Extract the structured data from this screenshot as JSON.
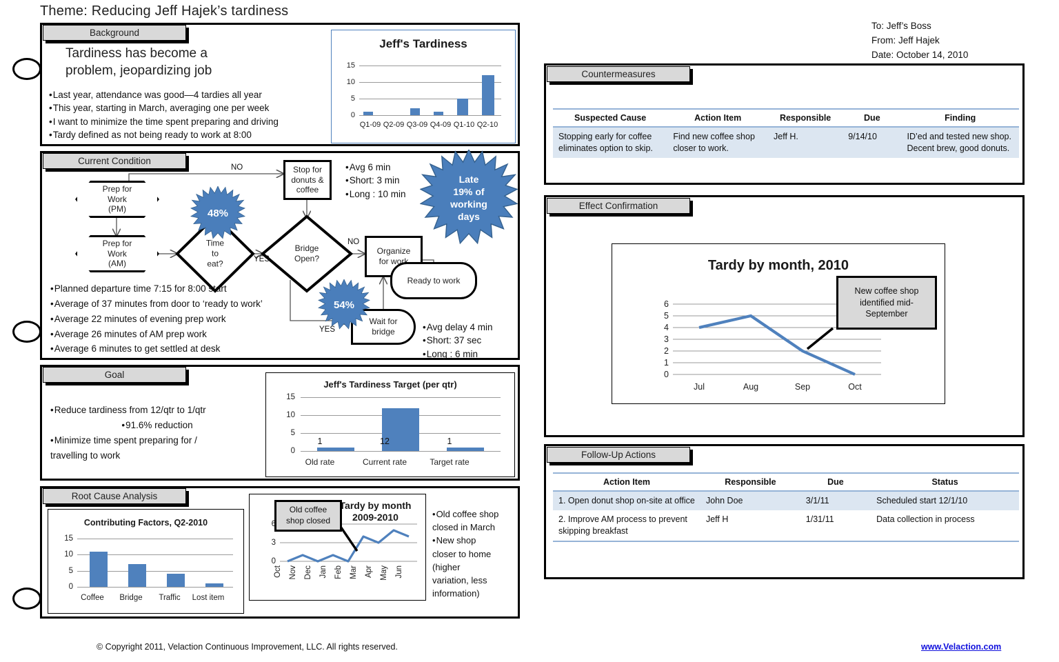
{
  "page": {
    "title": "Theme: Reducing Jeff Hajek’s tardiness",
    "footer_copyright": "© Copyright 2011, Velaction Continuous Improvement, LLC. All rights reserved.",
    "footer_link": "www.Velaction.com",
    "accent_blue": "#4F81BD",
    "burst_blue": "#4A7EBB",
    "header_gray": "#d9d9d9",
    "table_rule": "#95b3d7",
    "table_row_fill": "#dce6f1"
  },
  "memo": {
    "to": "To: Jeff’s Boss",
    "from": "From: Jeff Hajek",
    "date": "Date: October 14, 2010"
  },
  "background": {
    "header": "Background",
    "headline_line1": "Tardiness has become a",
    "headline_line2": "problem, jeopardizing  job",
    "bullets": [
      "Last year, attendance was good—4 tardies all year",
      "This year, starting in March, averaging one per week",
      "I want to minimize the time spent preparing and driving",
      "Tardy defined as not being ready to work at 8:00"
    ]
  },
  "current_condition": {
    "header": "Current Condition",
    "nodes": {
      "prep_pm": "Prep for Work (PM)",
      "prep_pm_l1": "Prep for",
      "prep_pm_l2": "Work",
      "prep_pm_l3": "(PM)",
      "prep_am_l1": "Prep for",
      "prep_am_l2": "Work",
      "prep_am_l3": "(AM)",
      "time_to_eat_l1": "Time",
      "time_to_eat_l2": "to",
      "time_to_eat_l3": "eat?",
      "stop_donuts_l1": "Stop for",
      "stop_donuts_l2": "donuts &",
      "stop_donuts_l3": "coffee",
      "bridge_open_l1": "Bridge",
      "bridge_open_l2": "Open?",
      "organize_l1": "Organize",
      "organize_l2": "for work",
      "wait_bridge_l1": "Wait for",
      "wait_bridge_l2": "bridge",
      "ready_to_work": "Ready to work"
    },
    "edge_labels": {
      "no_top": "NO",
      "yes_eat": "YES",
      "no_bridge": "NO",
      "yes_bridge": "YES"
    },
    "bursts": {
      "eat_pct": "48%",
      "bridge_pct": "54%",
      "late_l1": "Late",
      "late_l2": "19% of",
      "late_l3": "working",
      "late_l4": "days"
    },
    "coffee_stats": [
      "Avg 6 min",
      "Short: 3 min",
      "Long : 10 min"
    ],
    "bridge_stats": [
      "Avg delay 4 min",
      "Short: 37 sec",
      "Long : 6 min"
    ],
    "bullets": [
      "Planned departure time 7:15 for 8:00 start",
      "Average of 37 minutes from door to ‘ready to work’",
      "Average 22 minutes of evening prep work",
      "Average 26 minutes of AM prep work",
      "Average 6 minutes to get settled at desk"
    ]
  },
  "goal": {
    "header": "Goal",
    "bullets": [
      "Reduce tardiness from 12/qtr to 1/qtr",
      "91.6% reduction",
      "Minimize time spent preparing for /",
      "travelling to work"
    ]
  },
  "root_cause": {
    "header": "Root Cause Analysis",
    "callout_l1": "Old coffee",
    "callout_l2": "shop closed",
    "notes": [
      "Old coffee shop",
      "closed in March",
      "New shop",
      "closer to home",
      "(higher",
      "variation, less",
      "information)"
    ]
  },
  "countermeasures": {
    "header": "Countermeasures",
    "columns": [
      "Suspected Cause",
      "Action Item",
      "Responsible",
      "Due",
      "Finding"
    ],
    "rows": [
      {
        "cause": "Stopping early for coffee eliminates option to skip.",
        "action": "Find new coffee shop closer to work.",
        "responsible": "Jeff H.",
        "due": "9/14/10",
        "finding": "ID’ed and tested new shop. Decent brew, good donuts."
      }
    ]
  },
  "effect_confirmation": {
    "header": "Effect Confirmation",
    "callout_l1": "New coffee shop",
    "callout_l2": "identified mid-",
    "callout_l3": "September"
  },
  "follow_up": {
    "header": "Follow-Up Actions",
    "columns": [
      "Action Item",
      "Responsible",
      "Due",
      "Status"
    ],
    "rows": [
      {
        "action": "1. Open donut shop on-site at office",
        "responsible": "John Doe",
        "due": "3/1/11",
        "status": "Scheduled start 12/1/10"
      },
      {
        "action": "2. Improve AM process to prevent skipping breakfast",
        "responsible": "Jeff H",
        "due": "1/31/11",
        "status": "Data collection in process"
      }
    ]
  },
  "chart_data": [
    {
      "id": "jeffs_tardiness",
      "type": "bar",
      "title": "Jeff's Tardiness",
      "categories": [
        "Q1-09",
        "Q2-09",
        "Q3-09",
        "Q4-09",
        "Q1-10",
        "Q2-10"
      ],
      "values": [
        1,
        0,
        2,
        1,
        5,
        12
      ],
      "yticks": [
        0,
        5,
        10,
        15
      ],
      "ylim": [
        0,
        15
      ],
      "xlabel": "",
      "ylabel": "",
      "grid": true,
      "legend": "none",
      "color": "#4F81BD"
    },
    {
      "id": "tardiness_target",
      "type": "bar",
      "title": "Jeff's Tardiness Target (per qtr)",
      "categories": [
        "Old rate",
        "Current rate",
        "Target rate"
      ],
      "values": [
        1,
        12,
        1
      ],
      "data_labels": [
        "1",
        "12",
        "1"
      ],
      "yticks": [
        0,
        5,
        10,
        15
      ],
      "ylim": [
        0,
        15
      ],
      "xlabel": "",
      "ylabel": "",
      "grid": true,
      "legend": "none",
      "color": "#4F81BD"
    },
    {
      "id": "contributing_factors",
      "type": "bar",
      "title": "Contributing Factors, Q2-2010",
      "categories": [
        "Coffee",
        "Bridge",
        "Traffic",
        "Lost item"
      ],
      "values": [
        11,
        7,
        4,
        1
      ],
      "yticks": [
        0,
        5,
        10,
        15
      ],
      "ylim": [
        0,
        15
      ],
      "xlabel": "",
      "ylabel": "",
      "grid": true,
      "legend": "none",
      "color": "#4F81BD"
    },
    {
      "id": "tardy_by_month_2009_2010",
      "type": "line",
      "title_l1": "Tardy by month",
      "title_l2": "2009-2010",
      "title": "Tardy by month 2009-2010",
      "categories": [
        "Oct",
        "Nov",
        "Dec",
        "Jan",
        "Feb",
        "Mar",
        "Apr",
        "May",
        "Jun"
      ],
      "values": [
        0,
        1,
        0,
        1,
        0,
        4,
        3,
        5,
        4
      ],
      "yticks": [
        0,
        3,
        6
      ],
      "ylim": [
        0,
        6
      ],
      "xlabel": "",
      "ylabel": "",
      "grid": true,
      "legend": "none",
      "annotation": "Old coffee shop closed",
      "color": "#4F81BD"
    },
    {
      "id": "tardy_by_month_2010",
      "type": "line",
      "title": "Tardy by month, 2010",
      "categories": [
        "Jul",
        "Aug",
        "Sep",
        "Oct"
      ],
      "values": [
        4,
        5,
        2,
        0
      ],
      "yticks": [
        0,
        1,
        2,
        3,
        4,
        5,
        6
      ],
      "ylim": [
        0,
        6
      ],
      "xlabel": "",
      "ylabel": "",
      "grid": true,
      "legend": "none",
      "annotation": "New coffee shop identified mid-September",
      "color": "#4F81BD"
    }
  ]
}
